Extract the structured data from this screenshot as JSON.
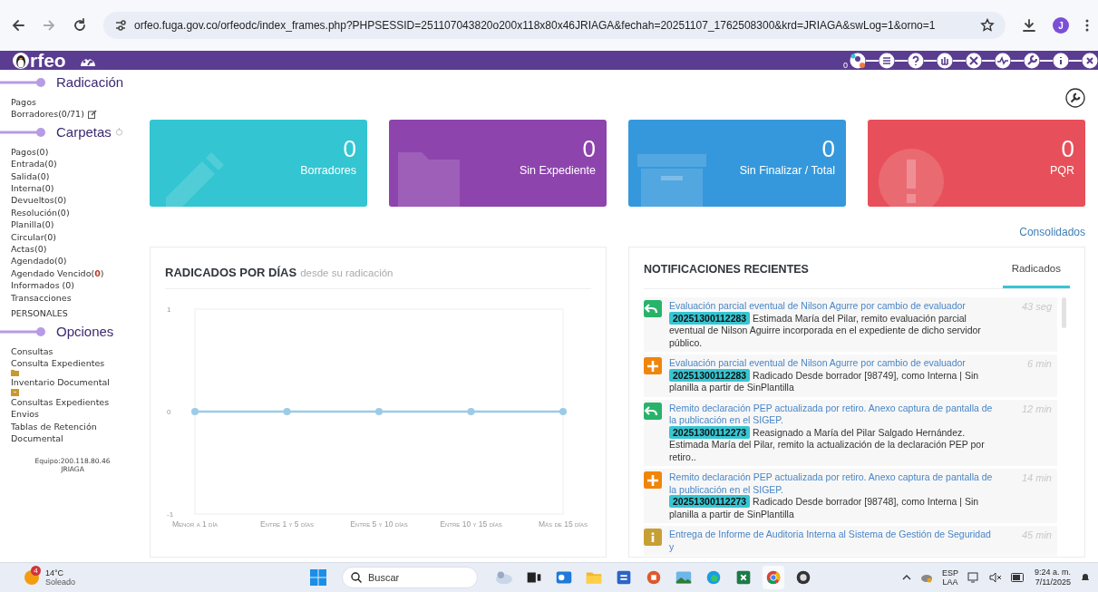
{
  "browser": {
    "url": "orfeo.fuga.gov.co/orfeodc/index_frames.php?PHPSESSID=251107043820o200x118x80x46JRIAGA&fechah=20251107_1762508300&krd=JRIAGA&swLog=1&orno=1",
    "profile": "J"
  },
  "header": {
    "logo": "rfeo",
    "counter": "0"
  },
  "sidebar": {
    "sections": [
      {
        "title": "Radicación",
        "kind": "plain",
        "items": [
          {
            "kind": "link",
            "label": "Pagos"
          },
          {
            "kind": "edit",
            "label": "Borradores(0/71)"
          }
        ]
      },
      {
        "title": "Carpetas",
        "kind": "refresh",
        "items": [
          {
            "kind": "link",
            "label": "Pagos(0)"
          },
          {
            "kind": "link",
            "label": "Entrada(0)"
          },
          {
            "kind": "link",
            "label": "Salida(0)"
          },
          {
            "kind": "link",
            "label": "Interna(0)"
          },
          {
            "kind": "link",
            "label": "Devueltos(0)"
          },
          {
            "kind": "link",
            "label": "Resolución(0)"
          },
          {
            "kind": "link",
            "label": "Planilla(0)"
          },
          {
            "kind": "link",
            "label": "Circular(0)"
          },
          {
            "kind": "link",
            "label": "Actas(0)"
          },
          {
            "kind": "link",
            "label": "Agendado(0)"
          },
          {
            "kind": "link",
            "label": "Agendado Vencido(**0**)"
          },
          {
            "kind": "link",
            "label": "Informados (0)"
          },
          {
            "kind": "link",
            "label": "Transacciones"
          },
          {
            "kind": "heading",
            "label": "PERSONALES"
          }
        ]
      },
      {
        "title": "Opciones",
        "kind": "plain",
        "items": [
          {
            "kind": "link",
            "label": "Consultas"
          },
          {
            "kind": "link",
            "label": "Consulta Expedientes"
          },
          {
            "kind": "folder"
          },
          {
            "kind": "link",
            "label": "Inventario Documental"
          },
          {
            "kind": "archive"
          },
          {
            "kind": "link",
            "label": "Consultas Expedientes"
          },
          {
            "kind": "link",
            "label": "Envios"
          },
          {
            "kind": "link",
            "label": "Tablas de Retención Documental"
          }
        ]
      }
    ],
    "footer": [
      "Equipo:200.118.80.46",
      "JRIAGA"
    ]
  },
  "cards": [
    {
      "value": "0",
      "label": "Borradores",
      "color": "#33c5d1",
      "kind": "pencil"
    },
    {
      "value": "0",
      "label": "Sin Expediente",
      "color": "#8e44ad",
      "kind": "folder"
    },
    {
      "value": "0",
      "label": "Sin Finalizar / Total",
      "color": "#3598dc",
      "kind": "archive"
    },
    {
      "value": "0",
      "label": "PQR",
      "color": "#e7505a",
      "kind": "alert"
    }
  ],
  "consolidados": "Consolidados",
  "chart_panel": {
    "title": "RADICADOS POR DÍAS",
    "subtitle": "desde su radicación",
    "chart_data": {
      "type": "line",
      "categories": [
        "Menor a 1 día",
        "Entre 1 y 5 días",
        "Entre 5 y 10 días",
        "Entre 10 y 15 días",
        "Más de 15 días"
      ],
      "series": [
        {
          "color": "#9ccbe6",
          "marker": "circle",
          "values": [
            0,
            0,
            0,
            0,
            0
          ]
        }
      ],
      "ylim": [
        -1,
        1
      ],
      "yticks": [
        -1,
        0,
        1
      ]
    }
  },
  "notifications": {
    "title": "NOTIFICACIONES RECIENTES",
    "tabs": [
      {
        "label": "Radicados",
        "selected": true
      }
    ],
    "items": [
      {
        "kind": "reply",
        "title": "Evaluación parcial eventual de Nilson Agurre por cambio de evaluador",
        "code": "20251300112283",
        "text": "Estimada María del Pilar, remito evaluación parcial eventual de Nilson Aguirre incorporada en el expediente de dicho servidor público.",
        "time": "43 seg"
      },
      {
        "kind": "new",
        "title": "Evaluación parcial eventual de Nilson Agurre por cambio de evaluador",
        "code": "20251300112283",
        "text": "Radicado Desde borrador [98749], como Interna | Sin planilla a partir de SinPlantilla",
        "time": "6 min"
      },
      {
        "kind": "reply",
        "title": "Remito declaración PEP actualizada por retiro. Anexo captura de pantalla de la publicación en el SIGEP.",
        "code": "20251300112273",
        "text": "Reasignado a María del Pilar Salgado Hernández. Estimada María del Pilar, remito la actualización de la declaración PEP por retiro..",
        "time": "12 min"
      },
      {
        "kind": "new",
        "title": "Remito declaración PEP actualizada por retiro. Anexo captura de pantalla de la publicación en el SIGEP.",
        "code": "20251300112273",
        "text": "Radicado Desde borrador [98748], como Interna | Sin planilla a partir de SinPlantilla",
        "time": "14 min"
      },
      {
        "kind": "info",
        "title": "Entrega de Informe de Auditoria Interna al Sistema de Gestión de Seguridad y",
        "time": "45 min"
      }
    ]
  },
  "taskbar": {
    "weather": {
      "badge": "4",
      "temp": "14°C",
      "condition": "Soleado"
    },
    "search": {
      "placeholder": "Buscar"
    },
    "apps": [
      {
        "kind": "widget",
        "selected": false
      },
      {
        "kind": "taskview",
        "selected": false
      },
      {
        "kind": "outlook",
        "selected": false
      },
      {
        "kind": "files",
        "selected": false
      },
      {
        "kind": "word",
        "selected": false
      },
      {
        "kind": "powerpoint",
        "selected": false
      },
      {
        "kind": "photos",
        "selected": false
      },
      {
        "kind": "edge",
        "selected": false
      },
      {
        "kind": "excel",
        "selected": false
      },
      {
        "kind": "chrome",
        "selected": true
      },
      {
        "kind": "obs",
        "selected": false
      }
    ],
    "tray": {
      "language": "ESP",
      "layout": "LAA",
      "time": "9:24 a. m.",
      "date": "7/11/2025"
    }
  }
}
